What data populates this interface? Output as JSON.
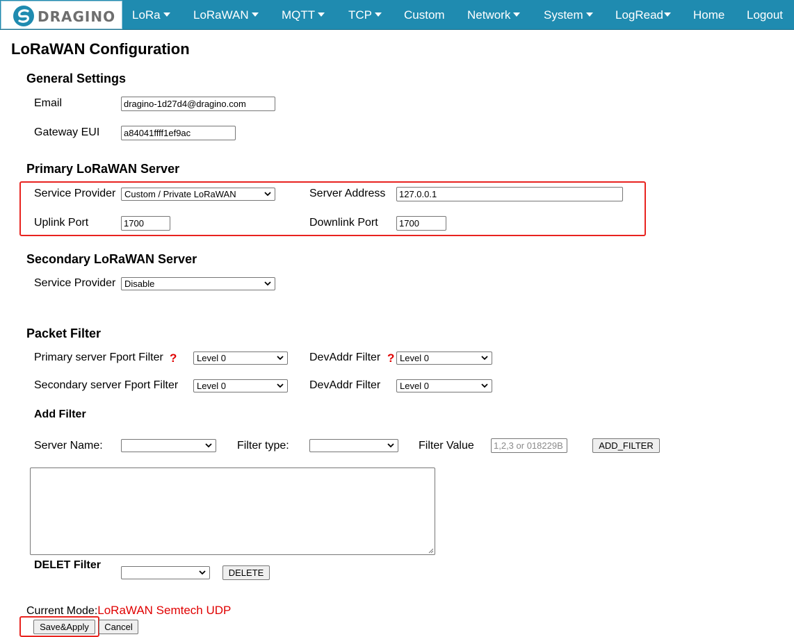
{
  "nav": {
    "brand": "DRAGINO",
    "items": [
      "LoRa",
      "LoRaWAN",
      "MQTT",
      "TCP",
      "Custom",
      "Network",
      "System",
      "LogRead",
      "Home",
      "Logout"
    ]
  },
  "page": {
    "title": "LoRaWAN Configuration"
  },
  "general": {
    "title": "General Settings",
    "email_label": "Email",
    "email_value": "dragino-1d27d4@dragino.com",
    "eui_label": "Gateway EUI",
    "eui_value": "a84041ffff1ef9ac"
  },
  "primary": {
    "title": "Primary LoRaWAN Server",
    "provider_label": "Service Provider",
    "provider_value": "Custom / Private LoRaWAN",
    "address_label": "Server Address",
    "address_value": "127.0.0.1",
    "uplink_label": "Uplink Port",
    "uplink_value": "1700",
    "downlink_label": "Downlink Port",
    "downlink_value": "1700"
  },
  "secondary": {
    "title": "Secondary LoRaWAN Server",
    "provider_label": "Service Provider",
    "provider_value": "Disable"
  },
  "filter": {
    "title": "Packet Filter",
    "primary_fport_label": "Primary server Fport Filter",
    "primary_fport_value": "Level 0",
    "devaddr_label": "DevAddr Filter",
    "primary_devaddr_value": "Level 0",
    "secondary_fport_label": "Secondary server Fport Filter",
    "secondary_fport_value": "Level 0",
    "secondary_devaddr_value": "Level 0",
    "help_mark": "?",
    "add_title": "Add Filter",
    "server_name_label": "Server Name:",
    "server_name_value": "",
    "filter_type_label": "Filter type:",
    "filter_type_value": "",
    "filter_value_label": "Filter Value",
    "filter_value_placeholder": "1,2,3 or 018229B",
    "add_button": "ADD_FILTER",
    "delete_title": "DELET Filter",
    "delete_select_value": "",
    "delete_button": "DELETE"
  },
  "footer": {
    "mode_label": "Current Mode:",
    "mode_value": "LoRaWAN Semtech UDP",
    "save_button": "Save&Apply",
    "cancel_button": "Cancel"
  },
  "colors": {
    "nav": "#1f8bb0",
    "highlight": "#e8231f",
    "mode": "#e00000"
  }
}
